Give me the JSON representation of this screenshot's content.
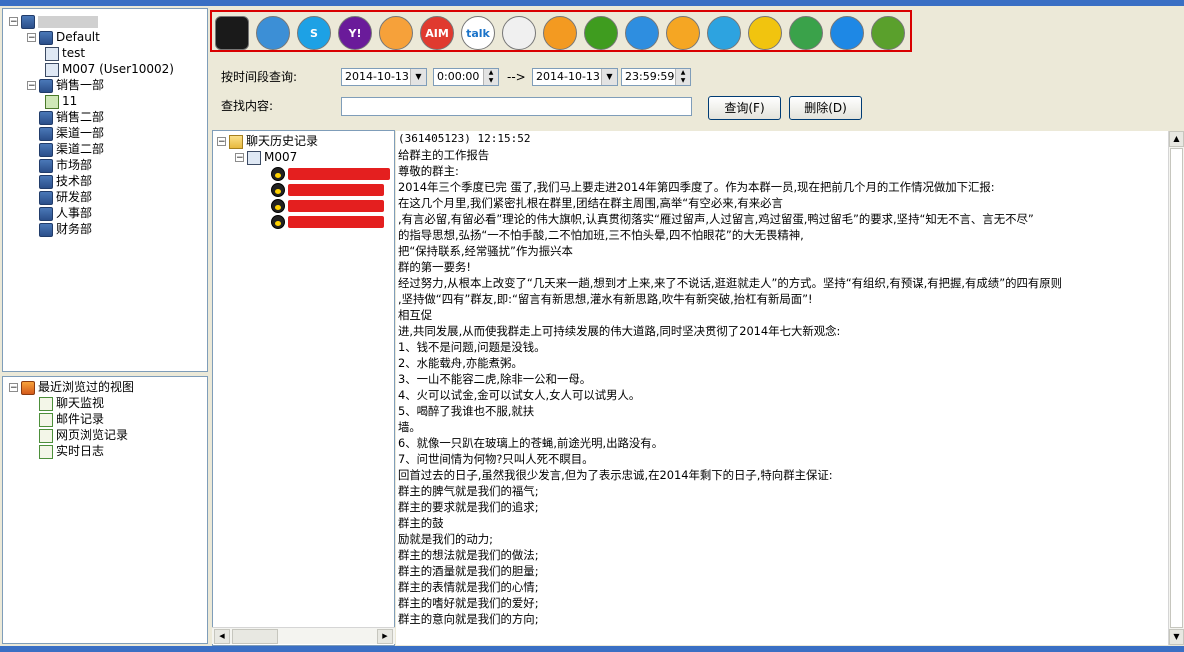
{
  "left_tree": {
    "items": [
      {
        "label": "Default",
        "level": 1
      },
      {
        "label": "test",
        "level": 2
      },
      {
        "label": "M007  (User10002)",
        "level": 2
      },
      {
        "label": "销售一部",
        "level": 1
      },
      {
        "label": "11",
        "level": 2
      },
      {
        "label": "销售二部",
        "level": 1
      },
      {
        "label": "渠道一部",
        "level": 1
      },
      {
        "label": "渠道二部",
        "level": 1
      },
      {
        "label": "市场部",
        "level": 1
      },
      {
        "label": "技术部",
        "level": 1
      },
      {
        "label": "研发部",
        "level": 1
      },
      {
        "label": "人事部",
        "level": 1
      },
      {
        "label": "财务部",
        "level": 1
      }
    ]
  },
  "views_tree": {
    "root": "最近浏览过的视图",
    "items": [
      "聊天监视",
      "邮件记录",
      "网页浏览记录",
      "实时日志"
    ]
  },
  "toolbar_icons": [
    {
      "name": "qq-icon",
      "color": "#1a1a1a",
      "text": ""
    },
    {
      "name": "msn-icon",
      "color": "#3c8fd6",
      "text": ""
    },
    {
      "name": "skype-icon",
      "color": "#1da1e5",
      "text": "S"
    },
    {
      "name": "yahoo-messenger-icon",
      "color": "#6a1b9a",
      "text": "Y!"
    },
    {
      "name": "ali-wangwang-icon",
      "color": "#f6a13a",
      "text": ""
    },
    {
      "name": "aim-icon",
      "color": "#e03a2f",
      "text": "AIM"
    },
    {
      "name": "google-talk-icon",
      "color": "#ffffff",
      "text": "talk"
    },
    {
      "name": "fetion-bird-icon",
      "color": "#f0f0f0",
      "text": ""
    },
    {
      "name": "acorn-icon",
      "color": "#f39a21",
      "text": ""
    },
    {
      "name": "icq-flower-icon",
      "color": "#3f9c1f",
      "text": ""
    },
    {
      "name": "bubble-icon",
      "color": "#2e8ee0",
      "text": ""
    },
    {
      "name": "chat-ball-icon",
      "color": "#f5a623",
      "text": ""
    },
    {
      "name": "robot-face-icon",
      "color": "#2da3e0",
      "text": ""
    },
    {
      "name": "leaf-icon",
      "color": "#f1c40f",
      "text": ""
    },
    {
      "name": "chat-bubbles-icon",
      "color": "#3aa24a",
      "text": ""
    },
    {
      "name": "colorful-circle-icon",
      "color": "#1e88e5",
      "text": ""
    },
    {
      "name": "download-icon",
      "color": "#5aa02c",
      "text": ""
    }
  ],
  "search": {
    "time_label": "按时间段查询:",
    "start_date": "2014-10-13",
    "start_time": "0:00:00",
    "arrow": "-->",
    "end_date": "2014-10-13",
    "end_time": "23:59:59",
    "content_label": "查找内容:",
    "content_value": "",
    "query_button": "查询(F)",
    "delete_button": "删除(D)"
  },
  "history_tree": {
    "root": "聊天历史记录",
    "child": "M007",
    "items": [
      "",
      "",
      "",
      ""
    ]
  },
  "chat": {
    "header": "(361405123) 12:15:52",
    "lines": [
      "给群主的工作报告",
      "尊敬的群主:",
      "      2014年三个季度已完 蛋了,我们马上要走进2014年第四季度了。作为本群一员,现在把前几个月的工作情况做加下汇报:",
      "      在这几个月里,我们紧密扎根在群里,团结在群主周围,高举“有空必来,有来必言",
      ",有言必留,有留必看”理论的伟大旗帜,认真贯彻落实“雁过留声,人过留言,鸡过留蛋,鸭过留毛”的要求,坚持“知无不言、言无不尽”",
      "的指导思想,弘扬“一不怕手酸,二不怕加班,三不怕头晕,四不怕眼花”的大无畏精神,",
      "把“保持联系,经常骚扰”作为振兴本",
      "群的第一要务!",
      "    经过努力,从根本上改变了“几天来一趟,想到才上来,来了不说话,逛逛就走人”的方式。坚持“有组织,有预谋,有把握,有成绩”的四有原则",
      ",坚持做“四有”群友,即:“留言有新思想,灌水有新思路,吹牛有新突破,抬杠有新局面”!",
      "相互促",
      "进,共同发展,从而使我群走上可持续发展的伟大道路,同时坚决贯彻了2014年七大新观念:",
      "1、钱不是问题,问题是没钱。",
      "2、水能载舟,亦能煮粥。",
      "3、一山不能容二虎,除非一公和一母。",
      "4、火可以试金,金可以试女人,女人可以试男人。",
      "5、喝醉了我谁也不服,就扶",
      "墙。",
      "6、就像一只趴在玻璃上的苍蝇,前途光明,出路没有。",
      "7、问世间情为何物?只叫人死不瞑目。",
      "      回首过去的日子,虽然我很少发言,但为了表示忠诚,在2014年剩下的日子,特向群主保证:",
      "群主的脾气就是我们的福气;",
      "群主的要求就是我们的追求;",
      "群主的鼓",
      "励就是我们的动力;",
      "群主的想法就是我们的做法;",
      "群主的酒量就是我们的胆量;",
      "群主的表情就是我们的心情;",
      "群主的嗜好就是我们的爱好;",
      "群主的意向就是我们的方向;"
    ]
  }
}
